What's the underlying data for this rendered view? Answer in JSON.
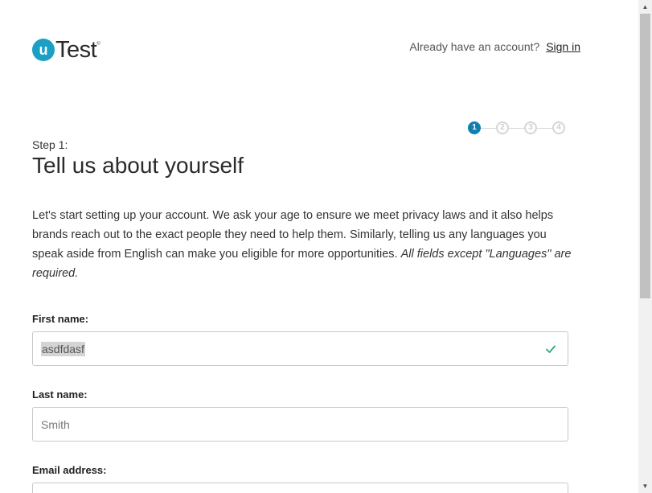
{
  "header": {
    "logo_letter": "u",
    "logo_text": "Test",
    "logo_reg": "®",
    "account_prompt": "Already have an account?",
    "signin_label": "Sign in"
  },
  "stepper": {
    "steps": [
      "1",
      "2",
      "3",
      "4"
    ],
    "current_step": 1
  },
  "main": {
    "step_label": "Step 1:",
    "title": "Tell us about yourself",
    "intro_text": "Let's start setting up your account. We ask your age to ensure we meet privacy laws and it also helps brands reach out to the exact people they need to help them. Similarly, telling us any languages you speak aside from English can make you eligible for more opportunities.",
    "intro_note": "All fields except \"Languages\" are required."
  },
  "form": {
    "first_name": {
      "label": "First name:",
      "value": "asdfdasf",
      "valid": true
    },
    "last_name": {
      "label": "Last name:",
      "placeholder": "Smith"
    },
    "email": {
      "label": "Email address:"
    }
  },
  "colors": {
    "brand": "#1b9fc4",
    "step_active": "#0f7fb0",
    "valid_check": "#2aa876"
  },
  "icons": {
    "valid": "check-icon",
    "scroll_up": "arrow-up-icon",
    "scroll_down": "arrow-down-icon"
  }
}
